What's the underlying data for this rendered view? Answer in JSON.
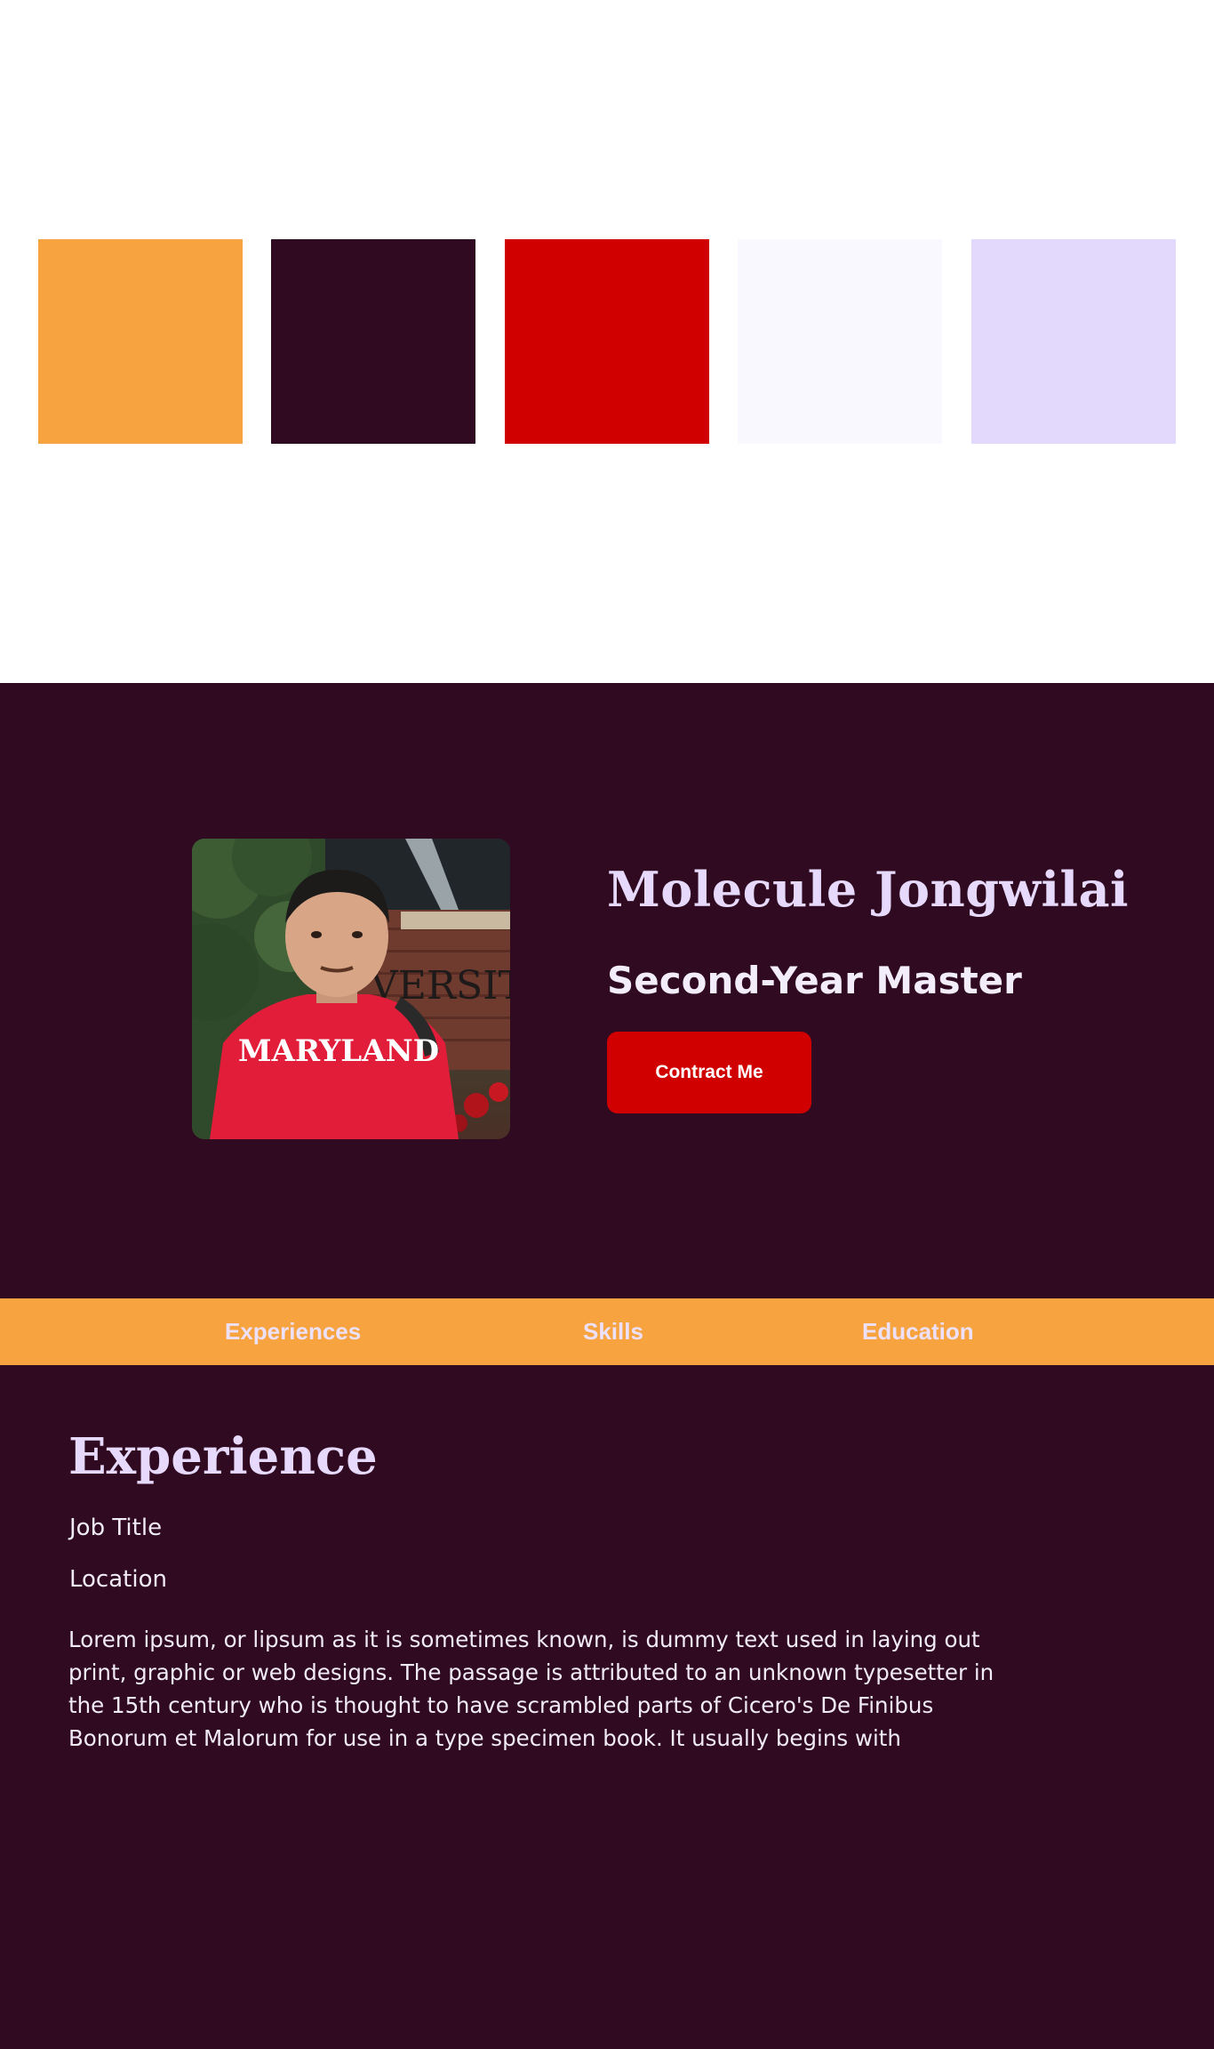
{
  "palette": {
    "swatches": [
      "#f7a440",
      "#2f0a20",
      "#d10000",
      "#faf8ff",
      "#e3d9fd"
    ]
  },
  "hero": {
    "name": "Molecule Jongwilai",
    "role": "Second-Year Master",
    "contact_label": "Contract Me",
    "photo": {
      "shirt_text": "MARYLAND",
      "sign_text": "VERSIT"
    }
  },
  "nav": {
    "items": [
      "Experiences",
      "Skills",
      "Education"
    ]
  },
  "experience": {
    "heading": "Experience",
    "job_title": "Job Title",
    "location": "Location",
    "description": "Lorem ipsum, or lipsum as it is sometimes known, is dummy text used in laying out print, graphic or web designs. The passage is attributed to an unknown typesetter in the 15th century who is thought to have scrambled parts of Cicero's De Finibus Bonorum et Malorum for use in a type specimen book. It usually begins with"
  },
  "colors": {
    "orange": "#f7a440",
    "plum": "#2f0a20",
    "red": "#d10000",
    "white": "#faf8ff",
    "lavender": "#e3d9fd"
  }
}
